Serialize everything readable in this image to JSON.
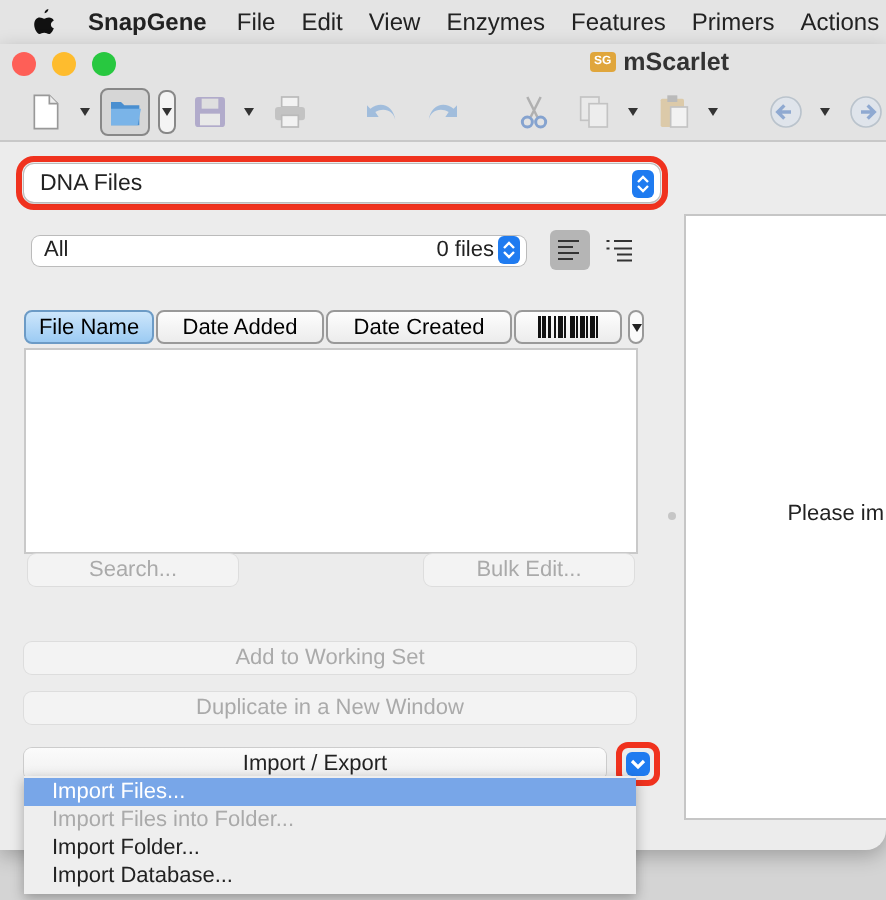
{
  "menu_bar": {
    "app": "SnapGene",
    "items": [
      "File",
      "Edit",
      "View",
      "Enzymes",
      "Features",
      "Primers",
      "Actions"
    ]
  },
  "window": {
    "title": "mScarlet",
    "document_badge": "SG"
  },
  "toolbar": [
    {
      "kind": "new",
      "disabled": false,
      "selected": false,
      "has_menu": true
    },
    {
      "kind": "open",
      "disabled": false,
      "selected": true,
      "has_menu": true
    },
    {
      "kind": "save",
      "disabled": true,
      "selected": false,
      "has_menu": true
    },
    {
      "kind": "print",
      "disabled": true,
      "selected": false,
      "has_menu": false
    },
    {
      "kind": "undo",
      "disabled": true,
      "selected": false,
      "has_menu": false
    },
    {
      "kind": "redo",
      "disabled": true,
      "selected": false,
      "has_menu": false
    },
    {
      "kind": "cut",
      "disabled": true,
      "selected": false,
      "has_menu": false
    },
    {
      "kind": "copy",
      "disabled": true,
      "selected": false,
      "has_menu": true
    },
    {
      "kind": "paste",
      "disabled": true,
      "selected": false,
      "has_menu": true
    },
    {
      "kind": "back",
      "disabled": true,
      "selected": false,
      "has_menu": true
    },
    {
      "kind": "forward",
      "disabled": true,
      "selected": false,
      "has_menu": false
    }
  ],
  "file_type_select": {
    "value": "DNA Files",
    "highlighted": true
  },
  "filter": {
    "value": "All",
    "count": "0 files"
  },
  "view_toggles": [
    {
      "kind": "list",
      "selected": true
    },
    {
      "kind": "outline",
      "selected": false
    }
  ],
  "columns": [
    {
      "kind": "text",
      "label": "File Name",
      "selected": true
    },
    {
      "kind": "text",
      "label": "Date Added",
      "selected": false
    },
    {
      "kind": "text",
      "label": "Date Created",
      "selected": false
    },
    {
      "kind": "barcode",
      "selected": false
    }
  ],
  "list_buttons": [
    {
      "label": "Search...",
      "disabled": true
    },
    {
      "label": "Bulk Edit...",
      "disabled": true
    }
  ],
  "actions": [
    {
      "label": "Add to Working Set",
      "disabled": true
    },
    {
      "label": "Duplicate in a New Window",
      "disabled": true
    }
  ],
  "import_export": {
    "label": "Import / Export",
    "menu_button_highlighted": true
  },
  "dropdown_menu": [
    {
      "label": "Import Files...",
      "selected": true,
      "disabled": false
    },
    {
      "label": "Import Files into Folder...",
      "selected": false,
      "disabled": true
    },
    {
      "label": "Import Folder...",
      "selected": false,
      "disabled": false
    },
    {
      "label": "Import Database...",
      "selected": false,
      "disabled": false
    }
  ],
  "preview": {
    "message": "Please im"
  }
}
